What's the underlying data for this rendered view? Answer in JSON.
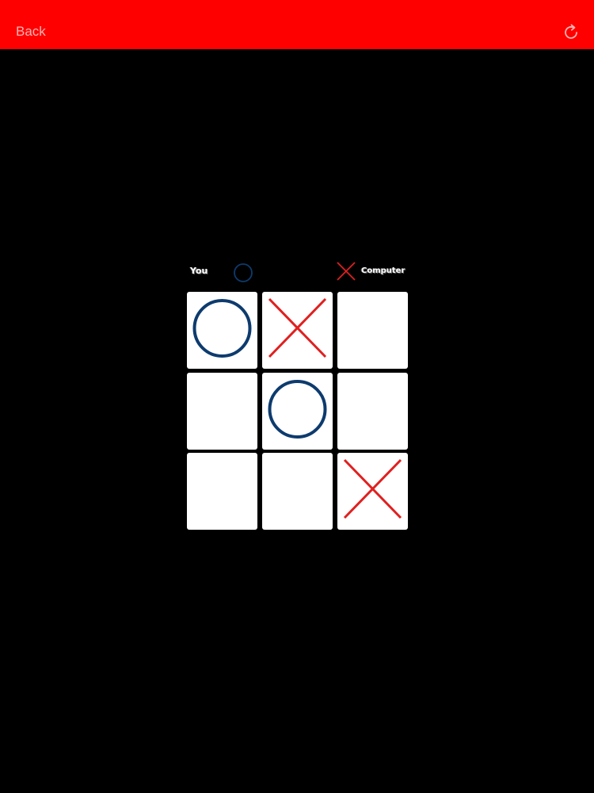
{
  "header": {
    "back_label": "Back",
    "refresh_icon": "refresh-icon",
    "bar_color": "#ff0000"
  },
  "players": {
    "you_label": "You",
    "you_mark": "O",
    "computer_label": "Computer",
    "computer_mark": "X"
  },
  "board": {
    "cells": [
      "O",
      "X",
      "",
      "",
      "O",
      "",
      "",
      "",
      "X"
    ]
  },
  "colors": {
    "o_color": "#0d3b6e",
    "x_color": "#e02020",
    "cell_color": "#ffffff",
    "background": "#000000"
  }
}
